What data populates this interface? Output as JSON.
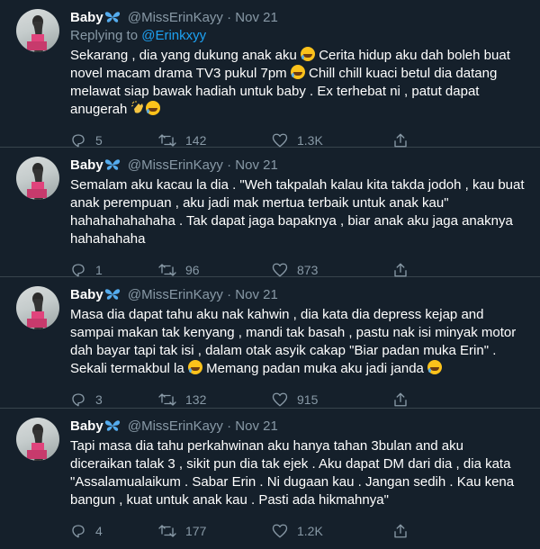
{
  "colors": {
    "background": "#15202b",
    "link": "#1da1f2",
    "muted": "#8899a6",
    "divider": "#38444d"
  },
  "icons": {
    "reply": "reply-icon",
    "retweet": "retweet-icon",
    "like": "heart-icon",
    "share": "share-icon",
    "badge": "butterfly-icon"
  },
  "tweets": [
    {
      "name": "Baby",
      "handle": "@MissErinKayy",
      "dot": "·",
      "date": "Nov 21",
      "replying_prefix": "Replying to ",
      "replying_to": "@Erinkxyy",
      "parts": [
        "Sekarang , dia yang dukung anak aku ",
        " Cerita hidup aku dah boleh buat novel macam drama TV3 pukul 7pm ",
        " Chill chill kuaci betul dia datang melawat siap bawak hadiah untuk baby . Ex terhebat ni , patut dapat anugerah "
      ],
      "replies": "5",
      "retweets": "142",
      "likes": "1.3K"
    },
    {
      "name": "Baby",
      "handle": "@MissErinKayy",
      "dot": "·",
      "date": "Nov 21",
      "text": "Semalam aku kacau la dia . \"Weh takpalah kalau kita takda jodoh , kau buat anak perempuan , aku jadi mak mertua terbaik untuk anak kau\" hahahahahahaha . Tak dapat jaga bapaknya , biar anak aku jaga anaknya hahahahaha",
      "replies": "1",
      "retweets": "96",
      "likes": "873"
    },
    {
      "name": "Baby",
      "handle": "@MissErinKayy",
      "dot": "·",
      "date": "Nov 21",
      "parts": [
        "Masa dia dapat tahu aku nak kahwin , dia kata dia depress kejap and sampai makan tak kenyang , mandi tak basah , pastu nak isi minyak motor dah bayar tapi tak isi , dalam otak asyik cakap \"Biar padan muka Erin\" . Sekali termakbul la ",
        " Memang padan muka aku jadi janda "
      ],
      "replies": "3",
      "retweets": "132",
      "likes": "915"
    },
    {
      "name": "Baby",
      "handle": "@MissErinKayy",
      "dot": "·",
      "date": "Nov 21",
      "text": "Tapi masa dia tahu perkahwinan aku hanya tahan 3bulan and aku diceraikan talak 3 , sikit pun dia tak ejek . Aku dapat DM dari dia , dia kata \"Assalamualaikum . Sabar Erin . Ni dugaan kau . Jangan sedih . Kau kena bangun , kuat untuk anak kau . Pasti ada hikmahnya\"",
      "replies": "4",
      "retweets": "177",
      "likes": "1.2K"
    }
  ]
}
